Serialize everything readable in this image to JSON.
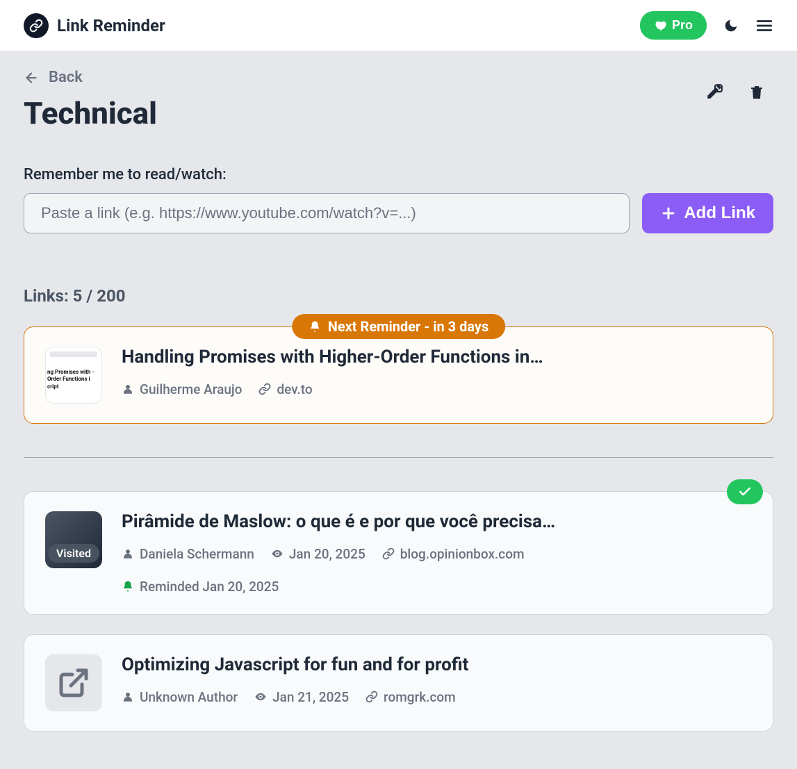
{
  "header": {
    "brand": "Link Reminder",
    "pro_label": "Pro"
  },
  "page": {
    "back_label": "Back",
    "title": "Technical",
    "input_label": "Remember me to read/watch:",
    "input_placeholder": "Paste a link (e.g. https://www.youtube.com/watch?v=...)",
    "add_link_label": "Add Link",
    "counter_label": "Links: 5 / 200",
    "reminder_badge": "Next Reminder - in 3 days"
  },
  "links": {
    "featured": {
      "title": "Handling Promises with Higher-Order Functions in…",
      "author": "Guilherme Araujo",
      "domain": "dev.to",
      "thumb_text": "ng Promises with\n-Order Functions i\ncript"
    },
    "list": [
      {
        "title": "Pirâmide de Maslow: o que é e por que você precisa…",
        "author": "Daniela Schermann",
        "date": "Jan 20, 2025",
        "domain": "blog.opinionbox.com",
        "reminded": "Reminded Jan 20, 2025",
        "visited_label": "Visited"
      },
      {
        "title": "Optimizing Javascript for fun and for profit",
        "author": "Unknown Author",
        "date": "Jan 21, 2025",
        "domain": "romgrk.com"
      }
    ]
  }
}
